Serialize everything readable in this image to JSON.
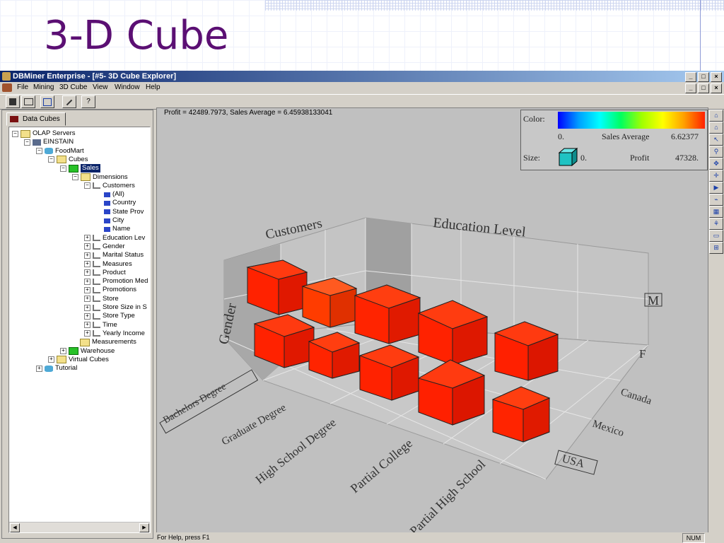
{
  "slide": {
    "title": "3-D Cube"
  },
  "window": {
    "title": "DBMiner Enterprise - [#5- 3D Cube Explorer]",
    "controls": [
      "_",
      "□",
      "×"
    ]
  },
  "menu": [
    "File",
    "Mining",
    "3D Cube",
    "View",
    "Window",
    "Help"
  ],
  "toolbar": {
    "help_label": "?"
  },
  "left_tab": {
    "label": "Data Cubes"
  },
  "tree": [
    {
      "label": "OLAP Servers",
      "icon": "folder-icon",
      "pm": "−"
    },
    {
      "label": "EINSTAIN",
      "icon": "server-icon",
      "pm": "−"
    },
    {
      "label": "FoodMart",
      "icon": "database-icon",
      "pm": "−"
    },
    {
      "label": "Cubes",
      "icon": "folder-icon",
      "pm": "−"
    },
    {
      "label": "Sales",
      "icon": "cube-icon",
      "pm": "−"
    },
    {
      "label": "Dimensions",
      "icon": "folder-icon",
      "pm": "−"
    },
    {
      "label": "Customers",
      "icon": "dimension-icon",
      "pm": "−"
    },
    {
      "label": "(All)",
      "icon": "level-icon",
      "pm": ""
    },
    {
      "label": "Country",
      "icon": "level-icon",
      "pm": ""
    },
    {
      "label": "State Prov",
      "icon": "level-icon",
      "pm": ""
    },
    {
      "label": "City",
      "icon": "level-icon",
      "pm": ""
    },
    {
      "label": "Name",
      "icon": "level-icon",
      "pm": ""
    },
    {
      "label": "Education Lev",
      "icon": "dimension-icon",
      "pm": "+"
    },
    {
      "label": "Gender",
      "icon": "dimension-icon",
      "pm": "+"
    },
    {
      "label": "Marital Status",
      "icon": "dimension-icon",
      "pm": "+"
    },
    {
      "label": "Measures",
      "icon": "dimension-icon",
      "pm": "+"
    },
    {
      "label": "Product",
      "icon": "dimension-icon",
      "pm": "+"
    },
    {
      "label": "Promotion Med",
      "icon": "dimension-icon",
      "pm": "+"
    },
    {
      "label": "Promotions",
      "icon": "dimension-icon",
      "pm": "+"
    },
    {
      "label": "Store",
      "icon": "dimension-icon",
      "pm": "+"
    },
    {
      "label": "Store Size in S",
      "icon": "dimension-icon",
      "pm": "+"
    },
    {
      "label": "Store Type",
      "icon": "dimension-icon",
      "pm": "+"
    },
    {
      "label": "Time",
      "icon": "dimension-icon",
      "pm": "+"
    },
    {
      "label": "Yearly Income",
      "icon": "dimension-icon",
      "pm": "+"
    },
    {
      "label": "Measurements",
      "icon": "folder-icon",
      "pm": ""
    },
    {
      "label": "Warehouse",
      "icon": "cube-icon",
      "pm": "+"
    },
    {
      "label": "Virtual Cubes",
      "icon": "folder-icon",
      "pm": "+"
    },
    {
      "label": "Tutorial",
      "icon": "database-icon",
      "pm": "+"
    }
  ],
  "main": {
    "info": "Profit = 42489.7973,  Sales Average = 6.45938133041"
  },
  "legend": {
    "color_label": "Color:",
    "color_min": "0.",
    "color_measure": "Sales Average",
    "color_max": "6.62377",
    "size_label": "Size:",
    "size_min": "0.",
    "size_measure": "Profit",
    "size_max": "47328."
  },
  "cube": {
    "axis_customers": "Customers",
    "axis_education": "Education Level",
    "axis_gender": "Gender",
    "gender_m": "M",
    "gender_f": "F",
    "countries": [
      "Canada",
      "Mexico",
      "USA"
    ],
    "education_levels": [
      "Bachelors Degree",
      "Graduate Degree",
      "High School Degree",
      "Partial College",
      "Partial High School"
    ]
  },
  "status": {
    "help": "For Help, press F1",
    "num": "NUM"
  },
  "colors": {
    "cube_red": "#ff2a00",
    "slide_title": "#5b0f73",
    "titlebar": "#0a246a"
  }
}
